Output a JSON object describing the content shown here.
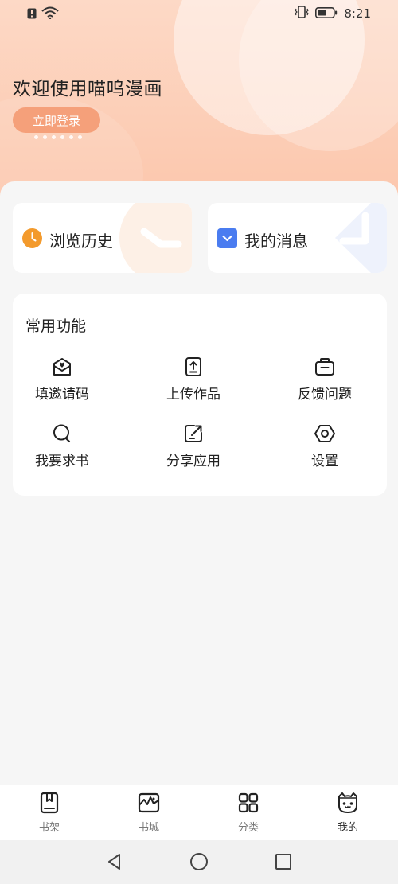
{
  "status_bar": {
    "time": "8:21",
    "icons": [
      "alert-icon",
      "wifi-icon",
      "vibrate-icon",
      "battery-icon"
    ]
  },
  "hero": {
    "welcome": "欢迎使用喵呜漫画",
    "login_label": "立即登录",
    "pager_dots": 6,
    "accent_color": "#f5a07a"
  },
  "quick_cards": {
    "history": {
      "label": "浏览历史",
      "icon": "clock-icon",
      "color": "#f39a2c"
    },
    "messages": {
      "label": "我的消息",
      "icon": "message-icon",
      "color": "#4a7cf0"
    }
  },
  "functions": {
    "title": "常用功能",
    "items": [
      {
        "label": "填邀请码",
        "icon": "invite-mail-icon"
      },
      {
        "label": "上传作品",
        "icon": "upload-icon"
      },
      {
        "label": "反馈问题",
        "icon": "feedback-icon"
      },
      {
        "label": "我要求书",
        "icon": "request-book-icon"
      },
      {
        "label": "分享应用",
        "icon": "share-icon"
      },
      {
        "label": "设置",
        "icon": "settings-icon"
      }
    ]
  },
  "tabs": [
    {
      "label": "书架",
      "icon": "bookshelf-icon",
      "active": false
    },
    {
      "label": "书城",
      "icon": "bookstore-icon",
      "active": false
    },
    {
      "label": "分类",
      "icon": "category-icon",
      "active": false
    },
    {
      "label": "我的",
      "icon": "cat-profile-icon",
      "active": true
    }
  ],
  "system_nav": [
    "back-icon",
    "home-icon",
    "recents-icon"
  ]
}
